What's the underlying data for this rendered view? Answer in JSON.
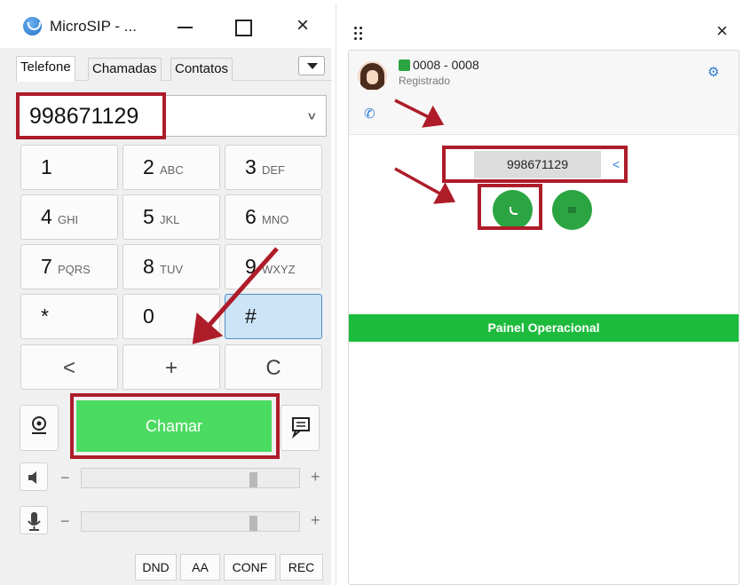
{
  "microsip": {
    "title": "MicroSIP - ...",
    "tabs": [
      "Telefone",
      "Chamadas",
      "Contatos"
    ],
    "number_value": "998671129",
    "keys": [
      {
        "main": "1",
        "sub": ""
      },
      {
        "main": "2",
        "sub": "ABC"
      },
      {
        "main": "3",
        "sub": "DEF"
      },
      {
        "main": "4",
        "sub": "GHI"
      },
      {
        "main": "5",
        "sub": "JKL"
      },
      {
        "main": "6",
        "sub": "MNO"
      },
      {
        "main": "7",
        "sub": "PQRS"
      },
      {
        "main": "8",
        "sub": "TUV"
      },
      {
        "main": "9",
        "sub": "WXYZ"
      },
      {
        "main": "*",
        "sub": ""
      },
      {
        "main": "0",
        "sub": ""
      },
      {
        "main": "#",
        "sub": ""
      }
    ],
    "controls": {
      "back": "<",
      "plus": "+",
      "clear": "C"
    },
    "call_label": "Chamar",
    "volume": {
      "minus": "−",
      "plus": "+",
      "speaker_level": 0.8,
      "mic_level": 0.8
    },
    "bottom_buttons": [
      "DND",
      "AA",
      "CONF",
      "REC"
    ],
    "pressed_key": "#"
  },
  "webphone": {
    "close": "×",
    "extension": "0008 - 0008",
    "status": "Registrado",
    "dial_value": "998671129",
    "backspace": "<",
    "bar_label": "Painel Operacional"
  },
  "colors": {
    "highlight": "#ae1c2a",
    "call_green": "#4cdb62",
    "web_green": "#1dbb3c",
    "link_blue": "#2a7bd4"
  }
}
